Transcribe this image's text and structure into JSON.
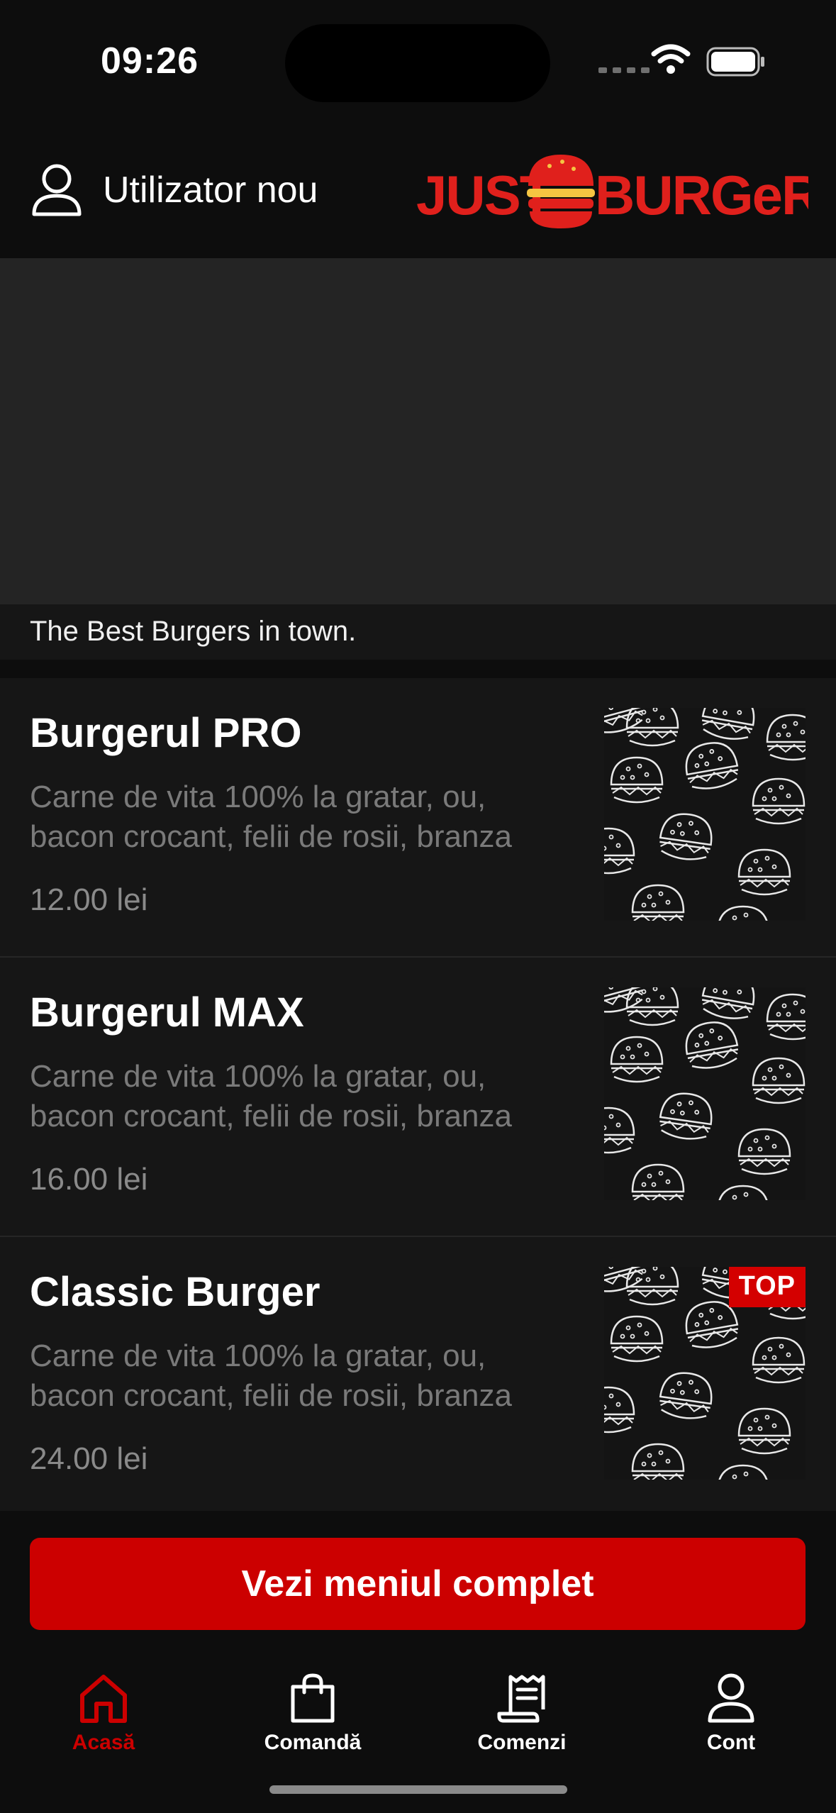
{
  "status": {
    "time": "09:26"
  },
  "header": {
    "user_label": "Utilizator nou",
    "logo_text": "JUST BURGERS"
  },
  "banner": {
    "tagline": "The Best Burgers in town."
  },
  "products": [
    {
      "name": "Burgerul PRO",
      "desc_line1": "Carne de vita 100% la gratar, ou,",
      "desc_line2": "bacon crocant, felii de rosii, branza",
      "price": "12.00 lei",
      "badge": ""
    },
    {
      "name": "Burgerul MAX",
      "desc_line1": "Carne de vita 100% la gratar, ou,",
      "desc_line2": "bacon crocant, felii de rosii, branza",
      "price": "16.00 lei",
      "badge": ""
    },
    {
      "name": "Classic Burger",
      "desc_line1": "Carne de vita 100% la gratar, ou,",
      "desc_line2": "bacon crocant, felii de rosii, branza",
      "price": "24.00 lei",
      "badge": "TOP"
    }
  ],
  "cta": {
    "label": "Vezi meniul complet"
  },
  "tabs": [
    {
      "label": "Acasă",
      "icon": "home-icon",
      "active": true
    },
    {
      "label": "Comandă",
      "icon": "bag-icon",
      "active": false
    },
    {
      "label": "Comenzi",
      "icon": "receipt-icon",
      "active": false
    },
    {
      "label": "Cont",
      "icon": "user-icon",
      "active": false
    }
  ],
  "colors": {
    "accent": "#cc0000",
    "background": "#0d0d0d",
    "card": "#161616",
    "banner": "#242424"
  }
}
